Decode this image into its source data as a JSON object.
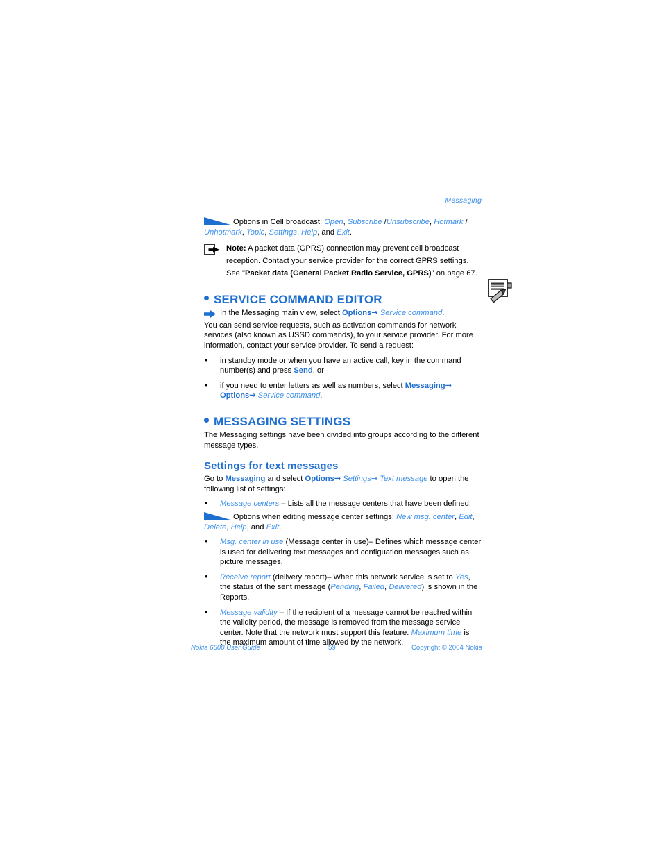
{
  "running_head": "Messaging",
  "colors": {
    "heading_blue": "#1f6fd0",
    "link_blue": "#3d8fe8",
    "body_black": "#000000"
  },
  "cell_broadcast_options": {
    "lead": "Options in Cell broadcast: ",
    "items_line1": [
      "Open",
      "Subscribe",
      "Unsubscribe",
      "Hotmark"
    ],
    "items_line2": [
      "Unhotmark",
      "Topic",
      "Settings",
      "Help",
      "Exit"
    ]
  },
  "note": {
    "label": "Note:",
    "text_1": " A packet data (GPRS) connection may prevent cell broadcast reception. Contact your service provider for the correct GPRS settings. See \"",
    "bold_ref": "Packet data (General Packet Radio Service, GPRS)",
    "text_2": "\" on page 67."
  },
  "service_command_editor": {
    "heading": "SERVICE COMMAND EDITOR",
    "arrow_line": {
      "pre": "In the Messaging main view, select ",
      "options": "Options",
      "arrow": "→",
      "target": "Service command",
      "period": "."
    },
    "paragraph": "You can send service requests, such as activation commands for network services (also known as USSD commands), to your service provider. For more information, contact your service provider. To send a request:",
    "bullets": [
      {
        "pre": "in standby mode or when you have an active call, key in the command number(s) and press ",
        "emph": "Send",
        "post": ", or"
      },
      {
        "pre": "if you need to enter letters as well as numbers, select ",
        "emph1": "Messaging",
        "arrow1": "→",
        "emph2": "Options",
        "arrow2": "→",
        "target": "Service command",
        "post": "."
      }
    ]
  },
  "messaging_settings": {
    "heading": "MESSAGING SETTINGS",
    "paragraph": "The Messaging settings have been divided into groups according to the different message types.",
    "subheading": "Settings for text messages",
    "intro": {
      "pre": "Go to ",
      "messaging": "Messaging",
      "mid": " and select ",
      "options": "Options",
      "arrow1": "→",
      "settings": "Settings",
      "arrow2": "→",
      "text_message": "Text message",
      "post": " to open the following list of settings:"
    },
    "bullets": [
      {
        "term": "Message centers",
        "text": " – Lists all the message centers that have been defined."
      }
    ],
    "editing_options_note": {
      "lead": "Options when editing message center settings: ",
      "items_line1": [
        "New msg. center",
        "Edit"
      ],
      "items_line2": [
        "Delete",
        "Help",
        "Exit"
      ]
    },
    "bullets_after": [
      {
        "term": "Msg. center in use",
        "text": " (Message center in use)– Defines which message center is used for delivering text messages and configuation messages such as picture messages."
      }
    ],
    "receive_report": {
      "term": "Receive report",
      "t1": " (delivery report)– When this network service is set to ",
      "yes": "Yes",
      "t2": ", the status of the sent message (",
      "pending": "Pending",
      "sep1": ", ",
      "failed": "Failed",
      "sep2": ", ",
      "delivered": "Delivered",
      "t3": ") is shown in the Reports."
    },
    "message_validity": {
      "term": "Message validity",
      "t1": " – If the recipient of a message cannot be reached within the validity period, the message is removed from the message service center. Note that the network must support this feature. ",
      "max_time": "Maximum time",
      "t2": " is the maximum amount of time allowed by the network."
    }
  },
  "footer": {
    "left": "Nokia 6600 User Guide",
    "page_number": "59",
    "right": "Copyright © 2004 Nokia"
  },
  "icons": {
    "options_wedge": "options-wedge-icon",
    "note": "note-exit-icon",
    "blue_arrow": "blue-right-arrow-icon",
    "notepad": "notepad-pencil-icon"
  }
}
